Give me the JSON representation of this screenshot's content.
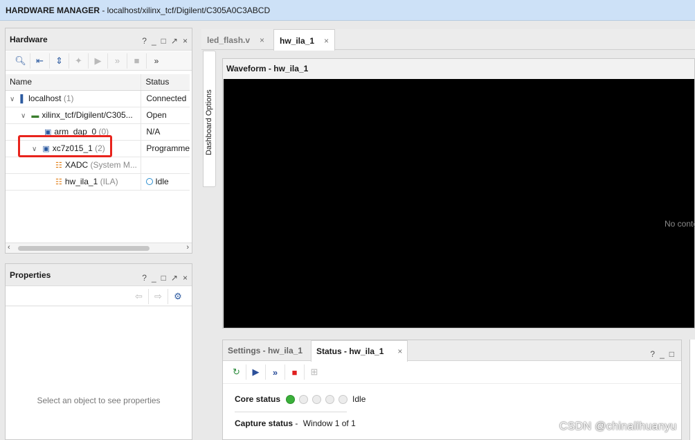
{
  "app": {
    "title_bold": "HARDWARE MANAGER",
    "title_path": " - localhost/xilinx_tcf/Digilent/C305A0C3ABCD"
  },
  "hardware_panel": {
    "title": "Hardware",
    "controls": [
      "?",
      "_",
      "□",
      "↗",
      "×"
    ],
    "toolbar_more": "»",
    "columns": [
      "Name",
      "Status"
    ],
    "rows": [
      {
        "name": "localhost",
        "suffix": " (1)",
        "status": "Connected",
        "icon": "server-icon"
      },
      {
        "name": "xilinx_tcf/Digilent/C305...",
        "suffix": "",
        "status": "Open",
        "icon": "board-icon"
      },
      {
        "name": "arm_dap_0",
        "suffix": " (0)",
        "status": "N/A",
        "icon": "chip-icon"
      },
      {
        "name": "xc7z015_1",
        "suffix": " (2)",
        "status": "Programme",
        "icon": "chip-icon"
      },
      {
        "name": "XADC",
        "suffix": " (System M...",
        "status": "",
        "icon": "core-icon"
      },
      {
        "name": "hw_ila_1",
        "suffix": " (ILA)",
        "status": "Idle",
        "icon": "core-icon"
      }
    ]
  },
  "properties_panel": {
    "title": "Properties",
    "controls": [
      "?",
      "_",
      "□",
      "↗",
      "×"
    ],
    "empty_message": "Select an object to see properties"
  },
  "editor_tabs": [
    {
      "label": "led_flash.v",
      "close": "×"
    },
    {
      "label": "hw_ila_1",
      "close": "×"
    }
  ],
  "dashboard_options": "Dashboard Options",
  "waveform": {
    "title": "Waveform - hw_ila_1",
    "no_content": "No conte"
  },
  "status_panel": {
    "tabs": [
      {
        "label": "Settings - hw_ila_1"
      },
      {
        "label": "Status - hw_ila_1",
        "close": "×"
      }
    ],
    "controls": [
      "?",
      "_",
      "□"
    ],
    "core_status_label": "Core status",
    "core_status_value": "Idle",
    "capture_status_label": "Capture status",
    "capture_status_sep": " - ",
    "capture_status_value": "Window 1 of 1"
  },
  "watermark": "CSDN @chinalihuanyu",
  "colors": {
    "titlebar_bg": "#cde1f7",
    "highlight_box": "#e8231c",
    "status_green": "#3ab03a",
    "stop_red": "#e02020",
    "toolbar_blue": "#2c5aa0"
  }
}
